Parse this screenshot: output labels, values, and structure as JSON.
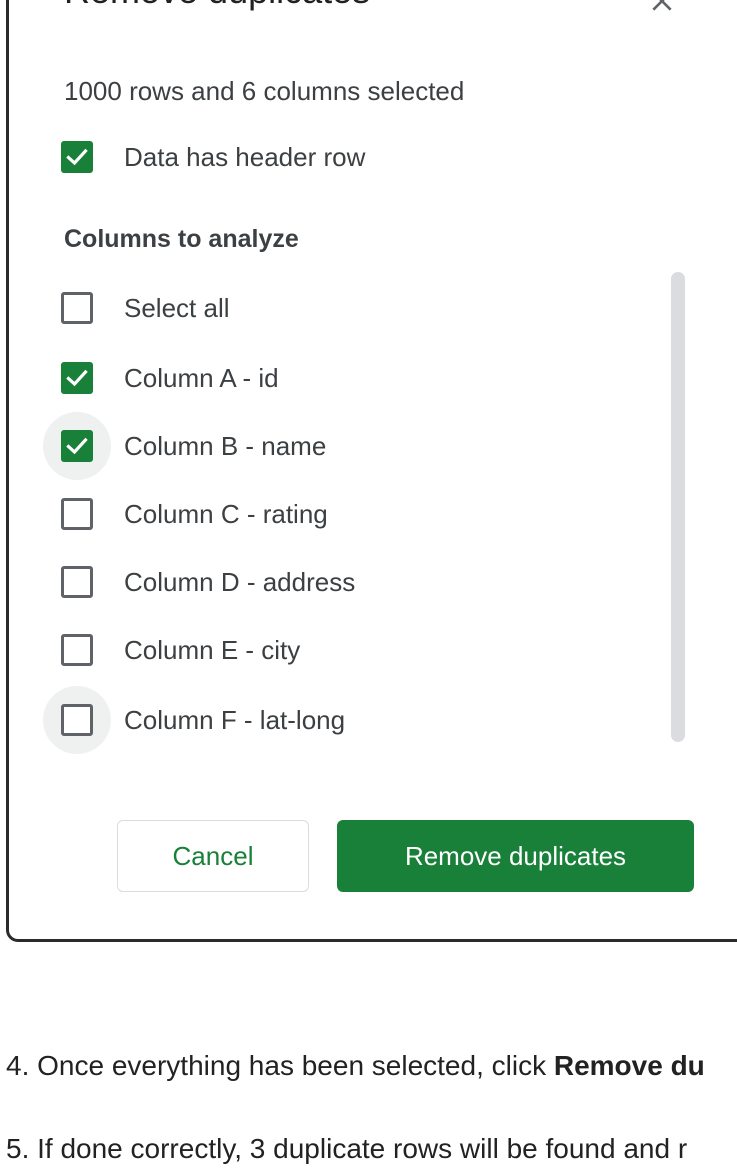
{
  "dialog": {
    "title": "Remove duplicates",
    "close_icon": "close-icon",
    "summary": "1000 rows and 6 columns selected",
    "header_row": {
      "label": "Data has header row",
      "checked": true
    },
    "columns_heading": "Columns to analyze",
    "select_all": {
      "label": "Select all",
      "checked": false
    },
    "columns": [
      {
        "label": "Column A - id",
        "checked": true
      },
      {
        "label": "Column B - name",
        "checked": true
      },
      {
        "label": "Column C - rating",
        "checked": false
      },
      {
        "label": "Column D - address",
        "checked": false
      },
      {
        "label": "Column E - city",
        "checked": false
      },
      {
        "label": "Column F - lat-long",
        "checked": false
      }
    ],
    "cancel_label": "Cancel",
    "remove_label": "Remove duplicates"
  },
  "instructions": {
    "step4_prefix": "4. Once everything has been selected, click ",
    "step4_bold": "Remove du",
    "step5": "5. If done correctly, 3 duplicate rows will be found and r"
  },
  "colors": {
    "accent": "#188038",
    "text": "#3c4043",
    "scrollbar": "#dadce0"
  }
}
